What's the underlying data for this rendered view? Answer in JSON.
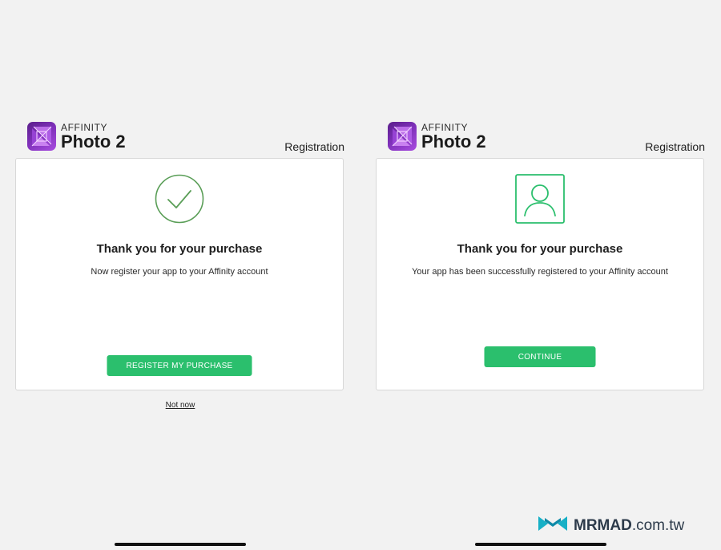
{
  "colors": {
    "page_background": "#f2f2f2",
    "card_background": "#ffffff",
    "accent_green": "#2bbf6d",
    "success_outline": "#5a9e57",
    "profile_outline": "#2bbf6d",
    "app_icon_purple": "#7d2fb8"
  },
  "panels": [
    {
      "brand": {
        "small": "AFFINITY",
        "big": "Photo 2",
        "icon": "affinity-photo-app-icon"
      },
      "header_label": "Registration",
      "card": {
        "icon": "checkmark-circle-icon",
        "title": "Thank you for your purchase",
        "subtitle": "Now register your app to your Affinity account",
        "button_label": "REGISTER MY PURCHASE"
      },
      "secondary_link": "Not now"
    },
    {
      "brand": {
        "small": "AFFINITY",
        "big": "Photo 2",
        "icon": "affinity-photo-app-icon"
      },
      "header_label": "Registration",
      "card": {
        "icon": "user-profile-icon",
        "title": "Thank you for your purchase",
        "subtitle": "Your app has been successfully registered to your Affinity account",
        "button_label": "CONTINUE"
      }
    }
  ],
  "watermark": {
    "brand": "MRMAD",
    "suffix": ".com.tw",
    "icon": "mrmad-logo-icon"
  }
}
